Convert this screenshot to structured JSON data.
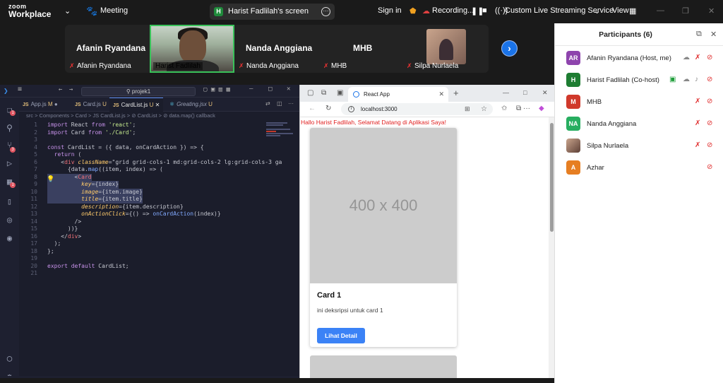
{
  "app": {
    "logo_top": "zoom",
    "logo_bottom": "Workplace"
  },
  "topbar": {
    "meeting_label": "Meeting",
    "share_label": "Harist Fadlilah's screen",
    "share_initial": "H",
    "signin_label": "Sign in",
    "recording_label": "Recording...",
    "streaming_label": "Custom Live Streaming Service",
    "view_label": "View"
  },
  "strip": {
    "tiles": [
      {
        "big": "Afanin Ryandana",
        "small": "Afanin Ryandana"
      },
      {
        "small": "Harist Fadlilah"
      },
      {
        "big": "Nanda  Anggiana",
        "small": "Nanda  Anggiana"
      },
      {
        "big": "MHB",
        "small": "MHB"
      },
      {
        "small": "Silpa Nurlaela"
      }
    ]
  },
  "vscode": {
    "search": "projek1",
    "tabs": [
      {
        "file": "App.js",
        "status": "M"
      },
      {
        "file": "Card.js",
        "status": "U"
      },
      {
        "file": "CardList.js",
        "status": "U"
      },
      {
        "file": "Greating.jsx",
        "status": "U"
      }
    ],
    "breadcrumb": "src > Components > Card > JS CardList.js > ⊘ CardList > ⊘ data.map() callback",
    "line_numbers": [
      "1",
      "2",
      "3",
      "4",
      "5",
      "6",
      "7",
      "8",
      "9",
      "10",
      "11",
      "12",
      "13",
      "14",
      "15",
      "16",
      "17",
      "18",
      "19",
      "20",
      "21"
    ],
    "code": [
      "import React from 'react';",
      "import Card from './Card';",
      "",
      "const CardList = ({ data, onCardAction }) => {",
      "  return (",
      "    <div className=\"grid grid-cols-1 md:grid-cols-2 lg:grid-cols-3 ga",
      "      {data.map((item, index) => (",
      "        <Card",
      "          key={index}",
      "          image={item.image}",
      "          title={item.title}",
      "          description={item.description}",
      "          onActionClick={() => onCardAction(index)}",
      "        />",
      "      ))}",
      "    </div>",
      "  );",
      "};",
      "",
      "export default CardList;",
      ""
    ]
  },
  "browser": {
    "tab_title": "React App",
    "url": "localhost:3000",
    "greeting": "Hallo Harist Fadlilah, Selamat Datang di Aplikasi Saya!",
    "card": {
      "placeholder": "400 x 400",
      "title": "Card 1",
      "description": "ini deksripsi untuk card 1",
      "button": "Lihat Detail"
    }
  },
  "participants": {
    "title": "Participants (6)",
    "list": [
      {
        "initials": "AR",
        "name": "Afanin Ryandana (Host, me)",
        "color": "#8e44ad"
      },
      {
        "initials": "H",
        "name": "Harist Fadlilah (Co-host)",
        "color": "#1e7d32"
      },
      {
        "initials": "M",
        "name": "MHB",
        "color": "#d0392b"
      },
      {
        "initials": "NA",
        "name": "Nanda  Anggiana",
        "color": "#27ae60"
      },
      {
        "initials": "",
        "name": "Silpa Nurlaela",
        "color": "#8d6e63"
      },
      {
        "initials": "A",
        "name": "Azhar",
        "color": "#e67e22"
      }
    ]
  }
}
